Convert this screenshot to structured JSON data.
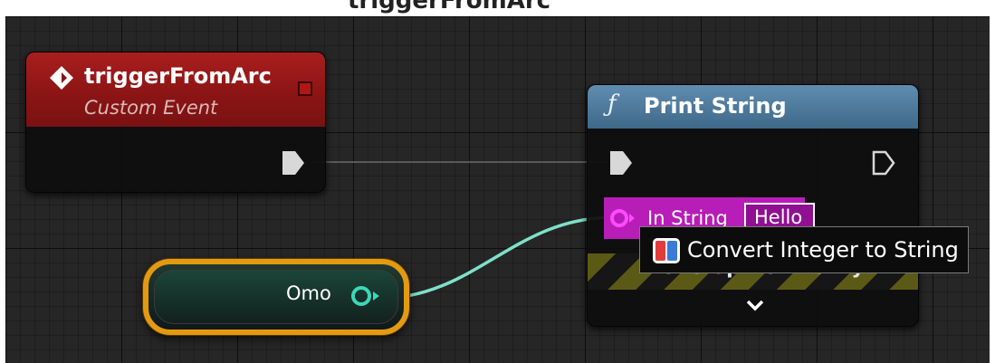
{
  "header_cut_text": "triggerFromArc",
  "event_node": {
    "title": "triggerFromArc",
    "subtitle": "Custom Event",
    "icon": "event-diamond-icon"
  },
  "print_node": {
    "title": "Print String",
    "function_icon": "ƒ",
    "in_string_label": "In String",
    "in_string_value": "Hello",
    "dev_only_label": "Development Only",
    "expand_icon": "chevron-down-icon"
  },
  "tooltip": {
    "text": "Convert Integer to String",
    "icon": "conversion-icon"
  },
  "variable_node": {
    "label": "Omo",
    "pin_color": "#3fd6b8"
  },
  "colors": {
    "event_header": "#a91e1f",
    "function_header": "#5f8db0",
    "string_pin": "#e020e0",
    "integer_pin": "#3fd6b8",
    "wire": "#7fe0c8",
    "selection": "#e39a10"
  }
}
